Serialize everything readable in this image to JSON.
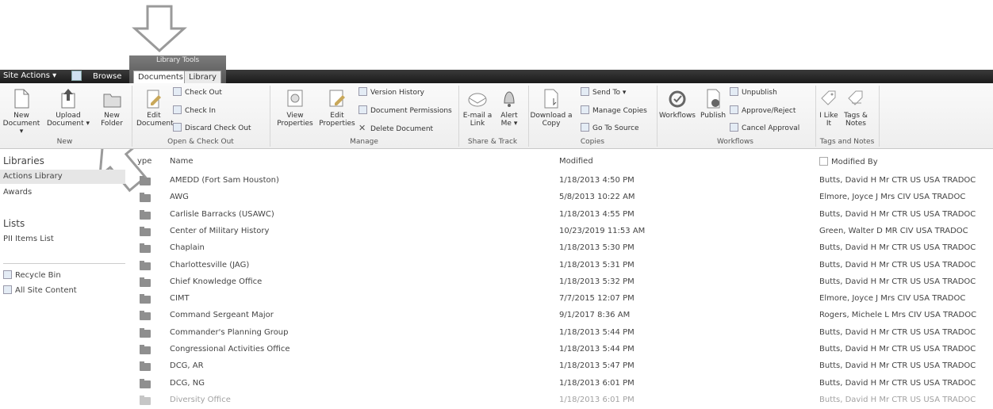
{
  "ribbon": {
    "site_actions": "Site Actions ▾",
    "browse": "Browse",
    "library_tools": "Library Tools",
    "tabs": [
      "Documents",
      "Library"
    ],
    "new": {
      "new_document": "New Document ▾",
      "upload_document": "Upload Document ▾",
      "new_folder": "New Folder",
      "label": "New"
    },
    "open_checkout": {
      "edit_document": "Edit Document",
      "check_out": "Check Out",
      "check_in": "Check In",
      "discard_check_out": "Discard Check Out",
      "label": "Open & Check Out"
    },
    "manage": {
      "view_properties": "View Properties",
      "edit_properties": "Edit Properties",
      "version_history": "Version History",
      "document_permissions": "Document Permissions",
      "delete_document": "Delete Document",
      "label": "Manage"
    },
    "share_track": {
      "email_link": "E-mail a Link",
      "alert_me": "Alert Me ▾",
      "label": "Share & Track"
    },
    "copies": {
      "download_copy": "Download a Copy",
      "send_to": "Send To ▾",
      "manage_copies": "Manage Copies",
      "go_to_source": "Go To Source",
      "label": "Copies"
    },
    "workflows": {
      "workflows": "Workflows",
      "publish": "Publish",
      "unpublish": "Unpublish",
      "approve_reject": "Approve/Reject",
      "cancel_approval": "Cancel Approval",
      "label": "Workflows"
    },
    "tags_notes": {
      "i_like_it": "I Like It",
      "tags_notes": "Tags & Notes",
      "label": "Tags and Notes"
    }
  },
  "nav": {
    "libraries_heading": "Libraries",
    "libraries": [
      "Actions Library",
      "Awards"
    ],
    "lists_heading": "Lists",
    "lists": [
      "PII Items List"
    ],
    "recycle_bin": "Recycle Bin",
    "all_site_content": "All Site Content"
  },
  "table": {
    "headers": {
      "type": "ype",
      "name": "Name",
      "modified": "Modified",
      "modified_by": "Modified By"
    },
    "rows": [
      {
        "name": "AMEDD (Fort Sam Houston)",
        "modified": "1/18/2013 4:50 PM",
        "modified_by": "Butts, David H Mr CTR US USA TRADOC"
      },
      {
        "name": "AWG",
        "modified": "5/8/2013 10:22 AM",
        "modified_by": "Elmore, Joyce J Mrs CIV USA TRADOC"
      },
      {
        "name": "Carlisle Barracks (USAWC)",
        "modified": "1/18/2013 4:55 PM",
        "modified_by": "Butts, David H Mr CTR US USA TRADOC"
      },
      {
        "name": "Center of Military History",
        "modified": "10/23/2019 11:53 AM",
        "modified_by": "Green, Walter D MR CIV USA TRADOC"
      },
      {
        "name": "Chaplain",
        "modified": "1/18/2013 5:30 PM",
        "modified_by": "Butts, David H Mr CTR US USA TRADOC"
      },
      {
        "name": "Charlottesville (JAG)",
        "modified": "1/18/2013 5:31 PM",
        "modified_by": "Butts, David H Mr CTR US USA TRADOC"
      },
      {
        "name": "Chief Knowledge Office",
        "modified": "1/18/2013 5:32 PM",
        "modified_by": "Butts, David H Mr CTR US USA TRADOC"
      },
      {
        "name": "CIMT",
        "modified": "7/7/2015 12:07 PM",
        "modified_by": "Elmore, Joyce J Mrs CIV USA TRADOC"
      },
      {
        "name": "Command Sergeant Major",
        "modified": "9/1/2017 8:36 AM",
        "modified_by": "Rogers, Michele L Mrs CIV USA TRADOC"
      },
      {
        "name": "Commander's Planning Group",
        "modified": "1/18/2013 5:44 PM",
        "modified_by": "Butts, David H Mr CTR US USA TRADOC"
      },
      {
        "name": "Congressional Activities Office",
        "modified": "1/18/2013 5:44 PM",
        "modified_by": "Butts, David H Mr CTR US USA TRADOC"
      },
      {
        "name": "DCG, AR",
        "modified": "1/18/2013 5:47 PM",
        "modified_by": "Butts, David H Mr CTR US USA TRADOC"
      },
      {
        "name": "DCG, NG",
        "modified": "1/18/2013 6:01 PM",
        "modified_by": "Butts, David H Mr CTR US USA TRADOC"
      },
      {
        "name": "Diversity Office",
        "modified": "1/18/2013 6:01 PM",
        "modified_by": "Butts, David H Mr CTR US USA TRADOC"
      }
    ]
  }
}
